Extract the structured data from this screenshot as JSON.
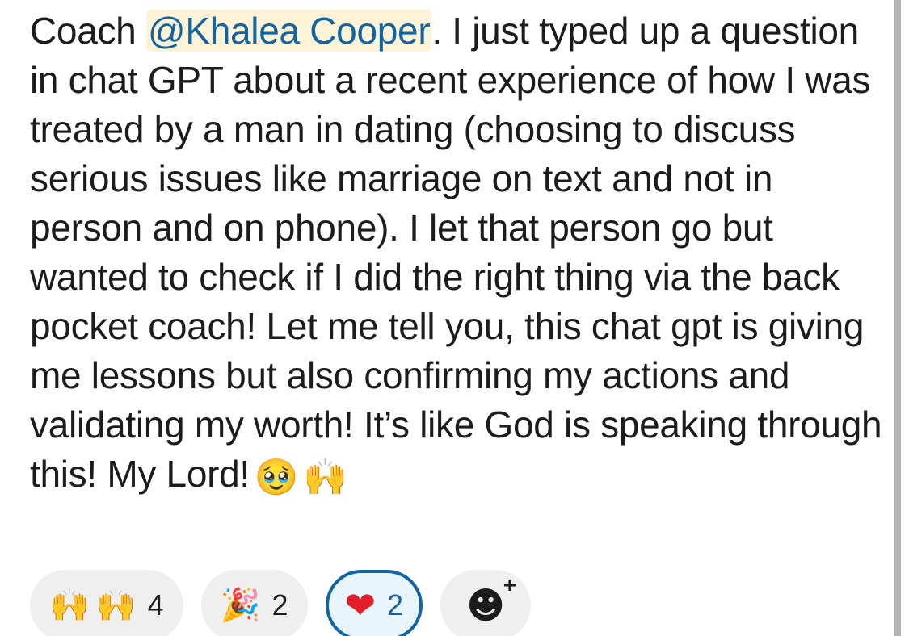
{
  "message": {
    "prefix": "Coach ",
    "mention": "@Khalea Cooper",
    "text": ". I just typed up a question in chat GPT about a recent experience of how I was treated by a man in dating (choosing to discuss serious issues like marriage on text and not in person and on phone). I let that person go but wanted to check if I did the right thing via the back pocket coach! Let me tell you, this chat gpt is giving me lessons but also confirming my actions and validating my worth! It’s like God is speaking through this! My Lord!",
    "emoji_1": "🥹",
    "emoji_2": "🙌"
  },
  "reactions": [
    {
      "emoji_1": "🙌",
      "emoji_2": "🙌",
      "icon": "raising-hands-icon",
      "count": "4",
      "selected": false
    },
    {
      "emoji": "🎉",
      "icon": "party-popper-icon",
      "count": "2",
      "selected": false
    },
    {
      "emoji": "❤",
      "icon": "heart-icon",
      "count": "2",
      "selected": true
    }
  ],
  "add_reaction": {
    "icon": "add-reaction-icon",
    "glyph": "☻",
    "plus": "+"
  },
  "colors": {
    "mention_text": "#1264a3",
    "mention_bg": "#fdf3d7",
    "selected_border": "#1264a3",
    "reaction_bg": "#efefef"
  }
}
